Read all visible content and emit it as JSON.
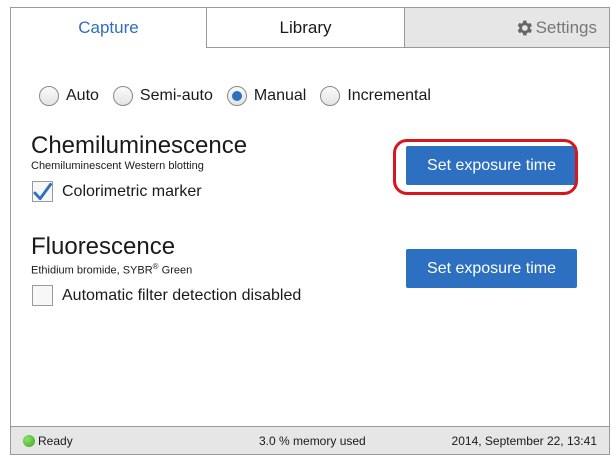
{
  "tabs": {
    "capture": "Capture",
    "library": "Library",
    "settings": "Settings",
    "settings_icon": "gear-icon"
  },
  "modes": {
    "options": [
      "Auto",
      "Semi-auto",
      "Manual",
      "Incremental"
    ],
    "selected": "Manual"
  },
  "chemi": {
    "title": "Chemiluminescence",
    "subtitle": "Chemiluminescent Western blotting",
    "checkbox_label": "Colorimetric marker",
    "checkbox_checked": true,
    "button_label": "Set exposure time"
  },
  "fluor": {
    "title": "Fluorescence",
    "subtitle_pre": "Ethidium bromide, SYBR",
    "subtitle_sup": "®",
    "subtitle_post": " Green",
    "checkbox_label": "Automatic filter detection disabled",
    "checkbox_checked": false,
    "button_label": "Set exposure time"
  },
  "status": {
    "ready": "Ready",
    "memory": "3.0 % memory used",
    "datetime": "2014, September 22, 13:41"
  },
  "colors": {
    "accent": "#2d6fc0",
    "highlight": "#d9161c",
    "status_ok": "#3aa320"
  }
}
